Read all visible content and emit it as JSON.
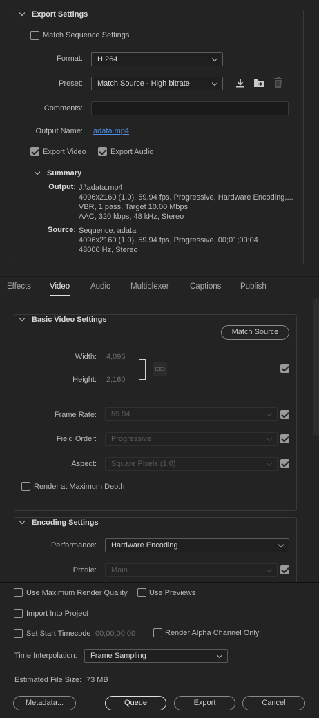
{
  "export_settings": {
    "title": "Export Settings",
    "match_sequence_label": "Match Sequence Settings",
    "match_sequence_checked": false,
    "format_label": "Format:",
    "format_value": "H.264",
    "preset_label": "Preset:",
    "preset_value": "Match Source - High bitrate",
    "comments_label": "Comments:",
    "comments_value": "",
    "output_name_label": "Output Name:",
    "output_name_value": "adata.mp4",
    "export_video_label": "Export Video",
    "export_video_checked": true,
    "export_audio_label": "Export Audio",
    "export_audio_checked": true,
    "summary": {
      "title": "Summary",
      "output_key": "Output:",
      "output_lines": [
        "J:\\adata.mp4",
        "4096x2160 (1.0), 59.94 fps, Progressive, Hardware Encoding,...",
        "VBR, 1 pass, Target 10.00 Mbps",
        "AAC, 320 kbps, 48 kHz, Stereo"
      ],
      "source_key": "Source:",
      "source_lines": [
        "Sequence, adata",
        "4096x2160 (1.0), 59.94 fps, Progressive, 00;01;00;04",
        "48000 Hz, Stereo"
      ]
    }
  },
  "tabs": [
    {
      "label": "Effects",
      "active": false
    },
    {
      "label": "Video",
      "active": true
    },
    {
      "label": "Audio",
      "active": false
    },
    {
      "label": "Multiplexer",
      "active": false
    },
    {
      "label": "Captions",
      "active": false
    },
    {
      "label": "Publish",
      "active": false
    }
  ],
  "basic_video": {
    "title": "Basic Video Settings",
    "match_source_button": "Match Source",
    "width_label": "Width:",
    "width_value": "4,096",
    "height_label": "Height:",
    "height_value": "2,160",
    "frame_rate_label": "Frame Rate:",
    "frame_rate_value": "59.94",
    "field_order_label": "Field Order:",
    "field_order_value": "Progressive",
    "aspect_label": "Aspect:",
    "aspect_value": "Square Pixels (1.0)",
    "render_max_depth_label": "Render at Maximum Depth"
  },
  "encoding": {
    "title": "Encoding Settings",
    "performance_label": "Performance:",
    "performance_value": "Hardware Encoding",
    "profile_label": "Profile:",
    "profile_value": "Main"
  },
  "bottom": {
    "use_max_render_quality": "Use Maximum Render Quality",
    "use_previews": "Use Previews",
    "import_into_project": "Import Into Project",
    "set_start_timecode": "Set Start Timecode",
    "start_timecode_value": "00;00;00;00",
    "render_alpha": "Render Alpha Channel Only",
    "time_interpolation_label": "Time Interpolation:",
    "time_interpolation_value": "Frame Sampling",
    "estimated_size_label": "Estimated File Size:",
    "estimated_size_value": "73 MB",
    "metadata_button": "Metadata...",
    "queue_button": "Queue",
    "export_button": "Export",
    "cancel_button": "Cancel"
  },
  "colors": {
    "background": "#232323",
    "link": "#4a90e2",
    "text": "#b8b8b8"
  }
}
